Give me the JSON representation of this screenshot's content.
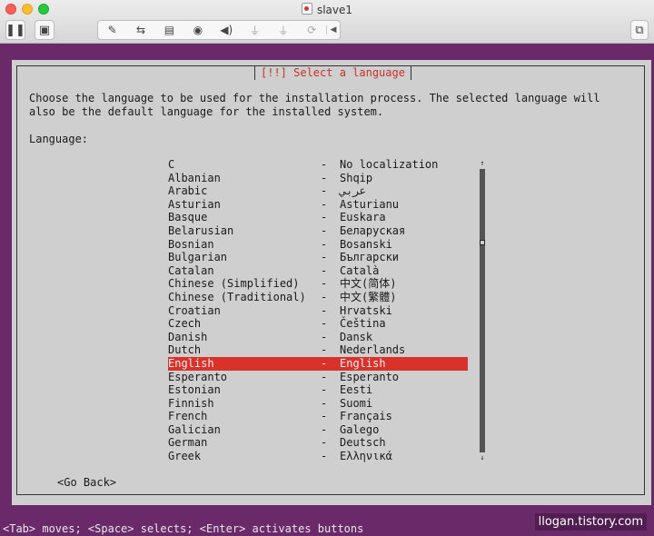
{
  "window": {
    "title": "slave1",
    "toolbar_icons": [
      "pause-icon",
      "snapshot-icon",
      "settings-wrench-icon",
      "network-arrows-icon",
      "hard-disk-icon",
      "optical-disc-icon",
      "sound-icon",
      "usb-icon",
      "usb-icon",
      "sync-icon",
      "chevron-left-icon",
      "fullscreen-icon"
    ]
  },
  "installer": {
    "title": "[!!] Select a language",
    "description": "Choose the language to be used for the installation process. The selected language will\nalso be the default language for the installed system.",
    "list_label": "Language:",
    "separator": "-",
    "languages": [
      {
        "name": "C",
        "native": "No localization"
      },
      {
        "name": "Albanian",
        "native": "Shqip"
      },
      {
        "name": "Arabic",
        "native": "عربي"
      },
      {
        "name": "Asturian",
        "native": "Asturianu"
      },
      {
        "name": "Basque",
        "native": "Euskara"
      },
      {
        "name": "Belarusian",
        "native": "Беларуская"
      },
      {
        "name": "Bosnian",
        "native": "Bosanski"
      },
      {
        "name": "Bulgarian",
        "native": "Български"
      },
      {
        "name": "Catalan",
        "native": "Català"
      },
      {
        "name": "Chinese (Simplified)",
        "native": "中文(简体)"
      },
      {
        "name": "Chinese (Traditional)",
        "native": "中文(繁體)"
      },
      {
        "name": "Croatian",
        "native": "Hrvatski"
      },
      {
        "name": "Czech",
        "native": "Čeština"
      },
      {
        "name": "Danish",
        "native": "Dansk"
      },
      {
        "name": "Dutch",
        "native": "Nederlands"
      },
      {
        "name": "English",
        "native": "English",
        "selected": true
      },
      {
        "name": "Esperanto",
        "native": "Esperanto"
      },
      {
        "name": "Estonian",
        "native": "Eesti"
      },
      {
        "name": "Finnish",
        "native": "Suomi"
      },
      {
        "name": "French",
        "native": "Français"
      },
      {
        "name": "Galician",
        "native": "Galego"
      },
      {
        "name": "German",
        "native": "Deutsch"
      },
      {
        "name": "Greek",
        "native": "Ελληνικά"
      }
    ],
    "scroll_up": "↑",
    "scroll_down": "↓",
    "go_back_label": "<Go Back>"
  },
  "status_bar": "<Tab> moves; <Space> selects; <Enter> activates buttons",
  "watermark": "llogan.tistory.com",
  "colors": {
    "vm_background": "#6a2a6a",
    "dialog": "#cfcfcf",
    "highlight": "#d8322a",
    "title_text": "#c8322a"
  }
}
